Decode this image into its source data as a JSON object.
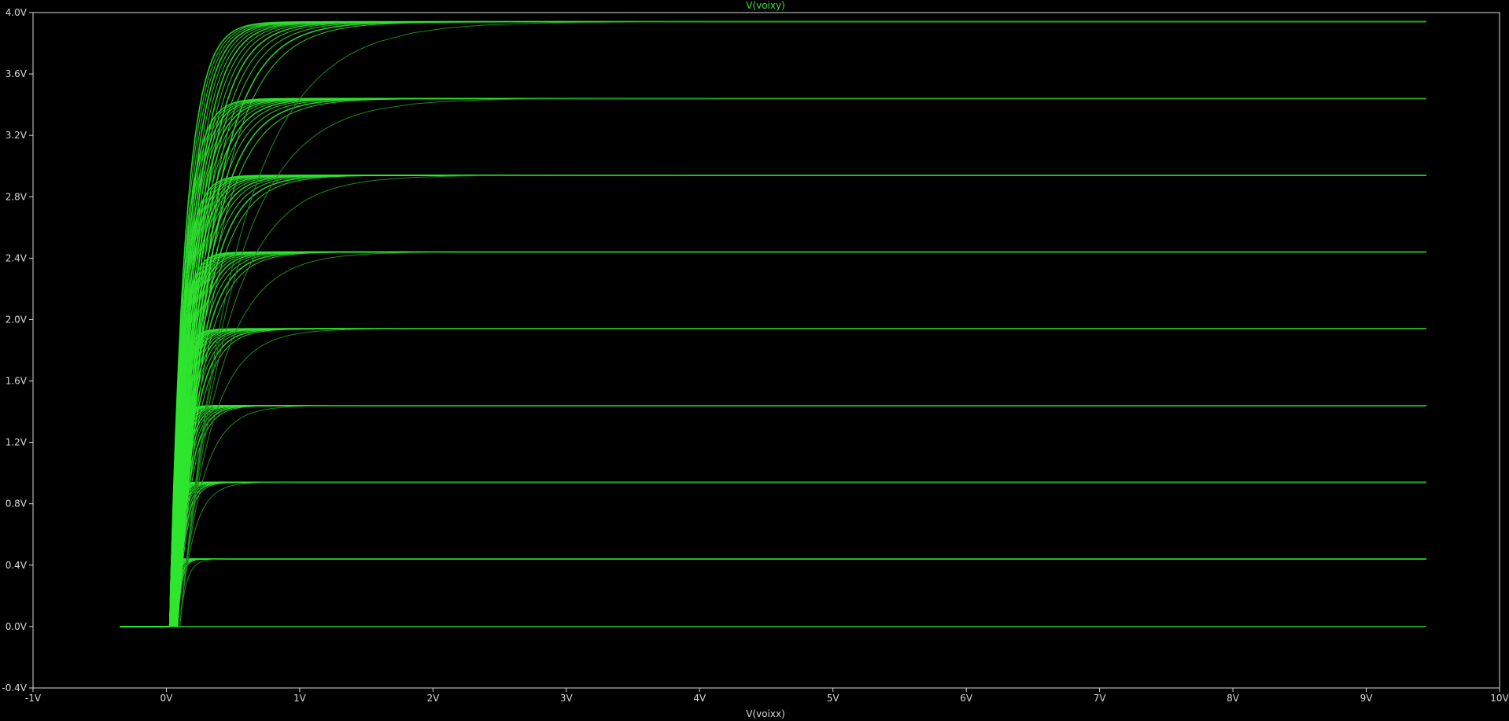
{
  "colors": {
    "background": "#000000",
    "frame": "#d8d8d8",
    "trace": "#2fe52f",
    "tick_text": "#d8d8d8"
  },
  "chart_data": {
    "type": "line",
    "title": "V(voixy)",
    "xlabel": "V(voixx)",
    "ylabel": "",
    "xlim": [
      -1,
      10
    ],
    "ylim": [
      -0.4,
      4.0
    ],
    "grid": false,
    "x_tick_labels": [
      "-1V",
      "0V",
      "1V",
      "2V",
      "3V",
      "4V",
      "5V",
      "6V",
      "7V",
      "8V",
      "9V",
      "10V"
    ],
    "y_tick_labels": [
      "4.0V",
      "3.6V",
      "3.2V",
      "2.8V",
      "2.4V",
      "2.0V",
      "1.6V",
      "1.2V",
      "0.8V",
      "0.4V",
      "0.0V",
      "-0.4V"
    ],
    "x_ticks": [
      -1,
      0,
      1,
      2,
      3,
      4,
      5,
      6,
      7,
      8,
      9,
      10
    ],
    "y_ticks": [
      4.0,
      3.6,
      3.2,
      2.8,
      2.4,
      2.0,
      1.6,
      1.2,
      0.8,
      0.4,
      0.0,
      -0.4
    ],
    "sweep": {
      "x_start": -0.35,
      "x_end": 9.45,
      "turn_on_x": 0.02,
      "saturation_levels": [
        0.0,
        0.44,
        0.94,
        1.44,
        1.94,
        2.44,
        2.94,
        3.44,
        3.94
      ]
    }
  }
}
